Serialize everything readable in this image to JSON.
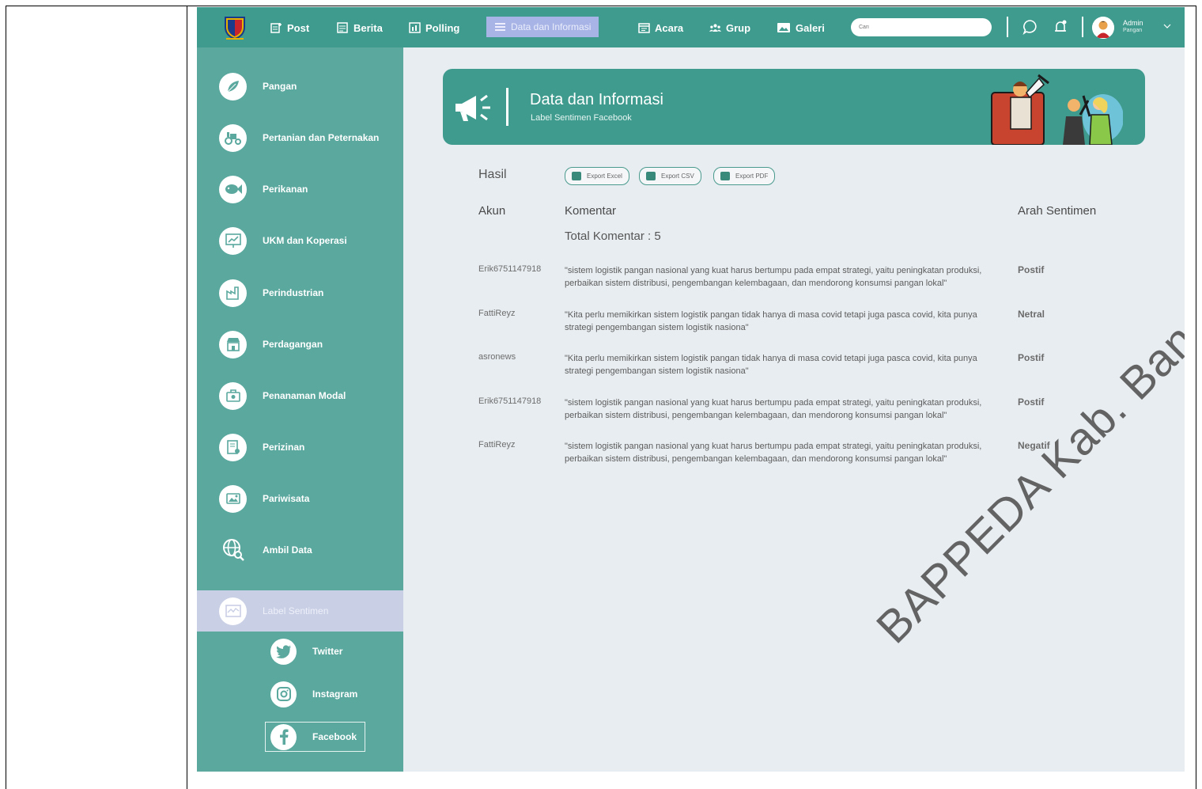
{
  "nav": {
    "items": [
      {
        "label": "Post",
        "icon": "post-icon"
      },
      {
        "label": "Berita",
        "icon": "newspaper-icon"
      },
      {
        "label": "Polling",
        "icon": "poll-icon"
      },
      {
        "label": "Data dan Informasi",
        "icon": "data-icon"
      },
      {
        "label": "Acara",
        "icon": "calendar-icon"
      },
      {
        "label": "Grup",
        "icon": "group-icon"
      },
      {
        "label": "Galeri",
        "icon": "gallery-icon"
      }
    ],
    "search_placeholder": "Cari",
    "user": {
      "name": "Admin",
      "role": "Pangan"
    }
  },
  "sidebar": {
    "items": [
      {
        "label": "Pangan"
      },
      {
        "label": "Pertanian dan Peternakan"
      },
      {
        "label": "Perikanan"
      },
      {
        "label": "UKM dan Koperasi"
      },
      {
        "label": "Perindustrian"
      },
      {
        "label": "Perdagangan"
      },
      {
        "label": "Penanaman Modal"
      },
      {
        "label": "Perizinan"
      },
      {
        "label": "Pariwisata"
      },
      {
        "label": "Ambil Data"
      }
    ],
    "active": {
      "label": "Label Sentimen"
    },
    "sub_items": [
      {
        "label": "Twitter"
      },
      {
        "label": "Instagram"
      },
      {
        "label": "Facebook"
      }
    ]
  },
  "banner": {
    "title": "Data dan Informasi",
    "subtitle": "Label Sentimen Facebook"
  },
  "results": {
    "heading": "Hasil",
    "export_excel": "Export Excel",
    "export_csv": "Export CSV",
    "export_pdf": "Export PDF",
    "col_akun": "Akun",
    "col_komentar": "Komentar",
    "col_sentimen": "Arah Sentimen",
    "total": "Total Komentar : 5",
    "rows": [
      {
        "akun": "Erik6751147918",
        "komentar": "\"sistem logistik pangan nasional yang kuat harus bertumpu pada empat strategi, yaitu peningkatan produksi, perbaikan sistem distribusi, pengembangan kelembagaan, dan mendorong konsumsi pangan lokal\"",
        "sentimen": "Postif"
      },
      {
        "akun": "FattiReyz",
        "komentar": "\"Kita perlu memikirkan sistem logistik pangan tidak hanya di masa covid tetapi juga pasca covid, kita punya strategi pengembangan sistem logistik nasiona\"",
        "sentimen": "Netral"
      },
      {
        "akun": "asronews",
        "komentar": "\"Kita perlu memikirkan sistem logistik pangan tidak hanya di masa covid tetapi juga pasca covid, kita punya strategi pengembangan sistem logistik nasiona\"",
        "sentimen": "Postif"
      },
      {
        "akun": "Erik6751147918",
        "komentar": "\"sistem logistik pangan nasional yang kuat harus bertumpu pada empat strategi, yaitu peningkatan produksi, perbaikan sistem distribusi, pengembangan kelembagaan, dan mendorong konsumsi pangan lokal\"",
        "sentimen": "Postif"
      },
      {
        "akun": "FattiReyz",
        "komentar": "\"sistem logistik pangan nasional yang kuat harus bertumpu pada empat strategi, yaitu peningkatan produksi, perbaikan sistem distribusi, pengembangan kelembagaan, dan mendorong konsumsi pangan lokal\"",
        "sentimen": "Negatif"
      }
    ]
  },
  "watermark": "BAPPEDA Kab. Bandung",
  "colors": {
    "primary": "#3e9b8e",
    "sidebar": "#5aa89e",
    "active_nav": "#a9b4e6",
    "background": "#e8edf1"
  }
}
